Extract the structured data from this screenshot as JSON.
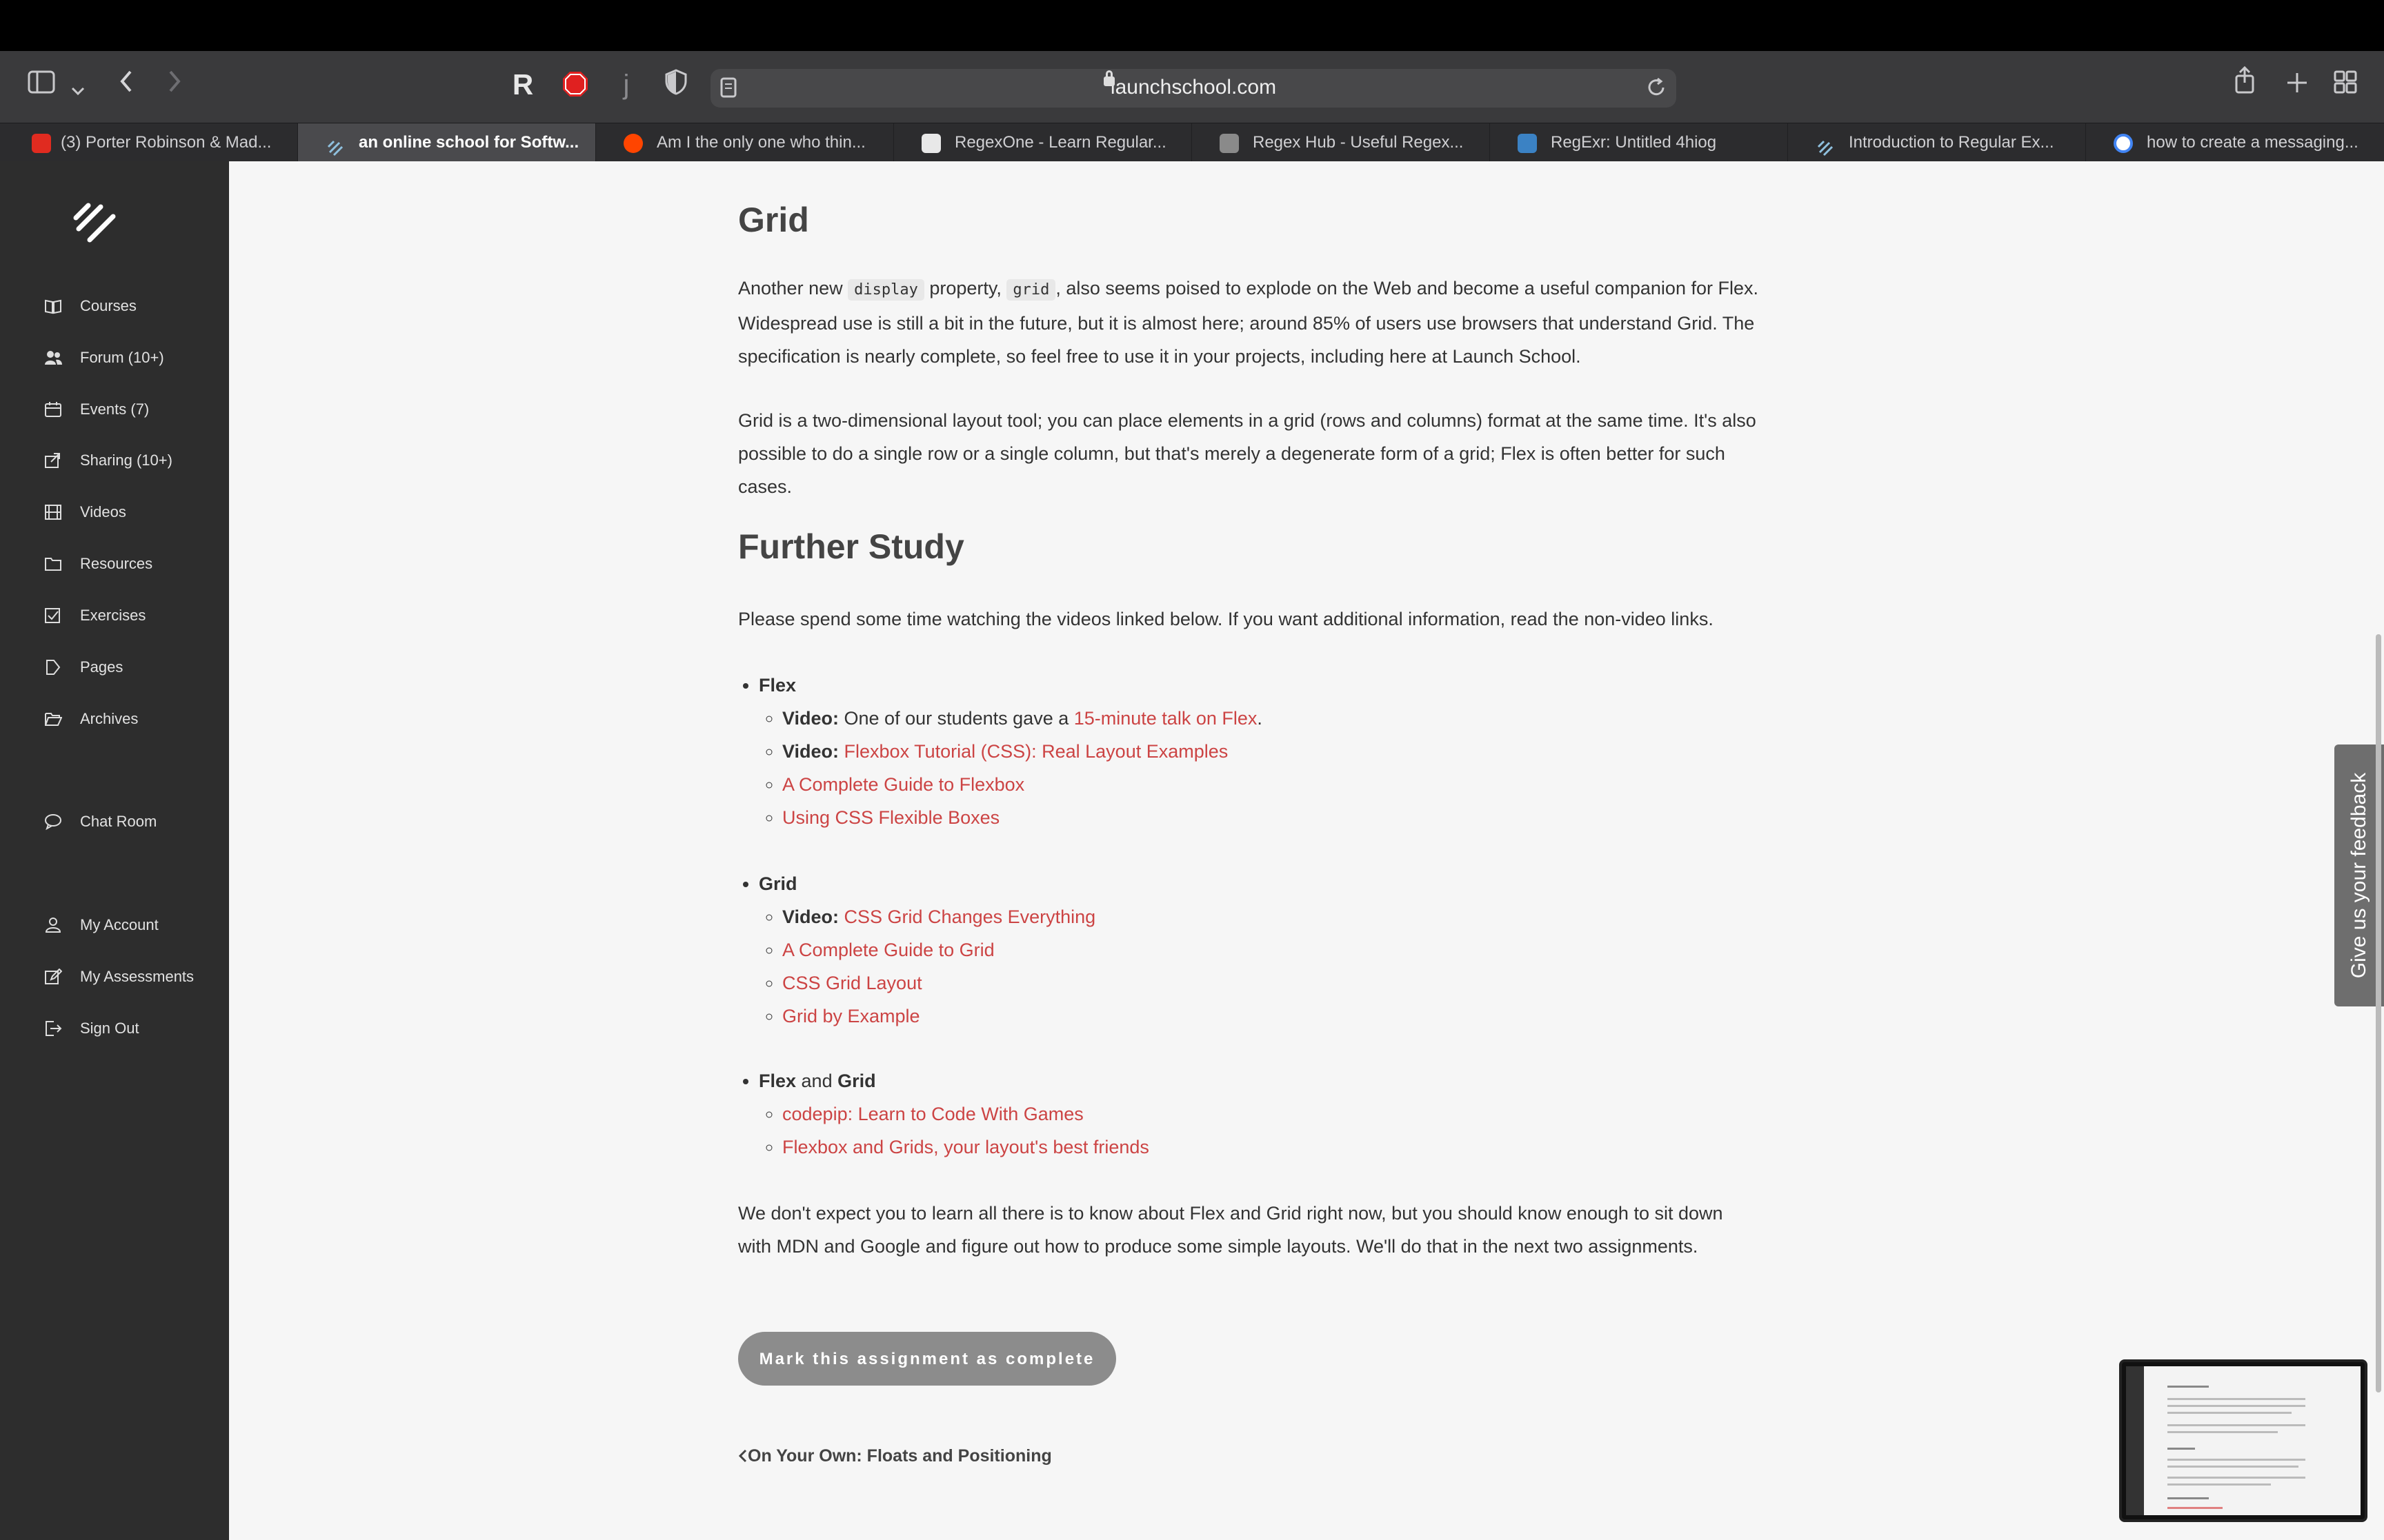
{
  "browser": {
    "url": "launchschool.com",
    "tabs": [
      {
        "label": "(3) Porter Robinson & Mad...",
        "icon_color": "#e02b20",
        "icon": "youtube-icon",
        "active": false
      },
      {
        "label": "an online school for Softw...",
        "icon_color": "#5aa0c9",
        "icon": "launchschool-icon",
        "active": true
      },
      {
        "label": "Am I the only one who thin...",
        "icon_color": "#ff4500",
        "icon": "reddit-icon",
        "active": false
      },
      {
        "label": "RegexOne - Learn Regular...",
        "icon_color": "#888888",
        "icon": "regexone-icon",
        "active": false
      },
      {
        "label": "Regex Hub - Useful Regex...",
        "icon_color": "#777777",
        "icon": "regexhub-icon",
        "active": false
      },
      {
        "label": "RegExr: Untitled 4hiog",
        "icon_color": "#3b82c4",
        "icon": "regexr-icon",
        "active": false
      },
      {
        "label": "Introduction to Regular Ex...",
        "icon_color": "#5aa0c9",
        "icon": "launchschool-icon",
        "active": false
      },
      {
        "label": "how to create a messaging...",
        "icon_color": "#4285f4",
        "icon": "google-icon",
        "active": false
      }
    ]
  },
  "sidebar": {
    "items": [
      {
        "label": "Courses",
        "icon": "book-icon"
      },
      {
        "label": "Forum (10+)",
        "icon": "users-icon"
      },
      {
        "label": "Events (7)",
        "icon": "calendar-icon"
      },
      {
        "label": "Sharing (10+)",
        "icon": "share-icon"
      },
      {
        "label": "Videos",
        "icon": "film-icon"
      },
      {
        "label": "Resources",
        "icon": "folder-icon"
      },
      {
        "label": "Exercises",
        "icon": "checkbox-icon"
      },
      {
        "label": "Pages",
        "icon": "page-icon"
      },
      {
        "label": "Archives",
        "icon": "open-folder-icon"
      },
      {
        "label": "Chat Room",
        "icon": "chat-icon"
      },
      {
        "label": "My Account",
        "icon": "user-icon"
      },
      {
        "label": "My Assessments",
        "icon": "edit-icon"
      },
      {
        "label": "Sign Out",
        "icon": "sign-out-icon"
      }
    ]
  },
  "article": {
    "grid_heading": "Grid",
    "grid_p1": {
      "t1": "Another new ",
      "code1": "display",
      "t2": " property, ",
      "code2": "grid",
      "t3": ", also seems poised to explode on the Web and become a useful companion for Flex. Widespread use is still a bit in the future, but it is almost here; around 85% of users use browsers that understand Grid. The specification is nearly complete, so feel free to use it in your projects, including here at Launch School."
    },
    "grid_p2": "Grid is a two-dimensional layout tool; you can place elements in a grid (rows and columns) format at the same time. It's also possible to do a single row or a single column, but that's merely a degenerate form of a grid; Flex is often better for such cases.",
    "further_heading": "Further Study",
    "further_intro": "Please spend some time watching the videos linked below. If you want additional information, read the non-video links.",
    "flex": {
      "title": "Flex",
      "video1_label": "Video:",
      "video1_text": " One of our students gave a ",
      "video1_link": "15-minute talk on Flex",
      "video1_end": ".",
      "video2_label": "Video:",
      "video2_link": "Flexbox Tutorial (CSS): Real Layout Examples",
      "link3": "A Complete Guide to Flexbox",
      "link4": "Using CSS Flexible Boxes"
    },
    "grid": {
      "title": "Grid",
      "video1_label": "Video:",
      "video1_link": "CSS Grid Changes Everything",
      "link2": "A Complete Guide to Grid",
      "link3": "CSS Grid Layout",
      "link4": "Grid by Example"
    },
    "both": {
      "title_a": "Flex",
      "and": " and ",
      "title_b": "Grid",
      "link1": "codepip: Learn to Code With Games",
      "link2": "Flexbox and Grids, your layout's best friends"
    },
    "closing": "We don't expect you to learn all there is to know about Flex and Grid right now, but you should know enough to sit down with MDN and Google and figure out how to produce some simple layouts. We'll do that in the next two assignments.",
    "complete_button": "Mark this assignment as complete",
    "prev_link": "On Your Own: Floats and Positioning"
  },
  "feedback_tab": "Give us your feedback"
}
